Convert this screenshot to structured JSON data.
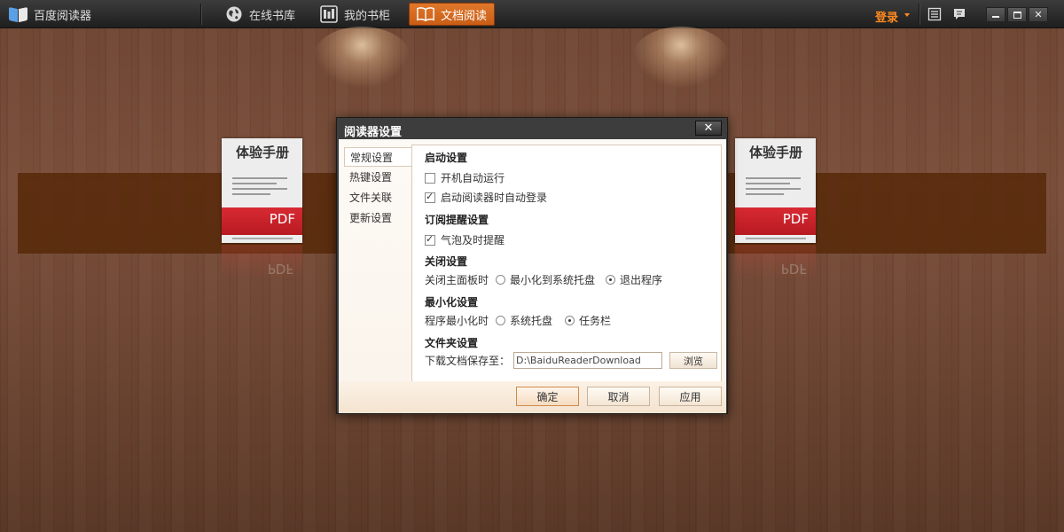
{
  "app": {
    "name": "百度阅读器"
  },
  "nav": {
    "tabs": [
      {
        "label": "在线书库",
        "icon": "globe-icon"
      },
      {
        "label": "我的书柜",
        "icon": "bookshelf-icon"
      },
      {
        "label": "文档阅读",
        "icon": "open-book-icon",
        "active": true
      }
    ],
    "login_label": "登录"
  },
  "colors": {
    "accent": "#d5661c",
    "login": "#ff8a1f",
    "shelf": "#5a2b0d",
    "pdf_red": "#c8202a"
  },
  "books": [
    {
      "title": "体验手册",
      "badge": "PDF"
    },
    {
      "title": "体验手册",
      "badge": "PDF"
    }
  ],
  "dialog": {
    "title": "阅读器设置",
    "close_label": "✕",
    "sidebar": [
      "常规设置",
      "热键设置",
      "文件关联",
      "更新设置"
    ],
    "sections": {
      "startup": {
        "title": "启动设置",
        "auto_run": {
          "label": "开机自动运行",
          "checked": false
        },
        "auto_login": {
          "label": "启动阅读器时自动登录",
          "checked": true
        }
      },
      "subscription": {
        "title": "订阅提醒设置",
        "bubble": {
          "label": "气泡及时提醒",
          "checked": true
        }
      },
      "close": {
        "title": "关闭设置",
        "prefix": "关闭主面板时",
        "options": [
          "最小化到系统托盘",
          "退出程序"
        ],
        "selected": 1
      },
      "minimize": {
        "title": "最小化设置",
        "prefix": "程序最小化时",
        "options": [
          "系统托盘",
          "任务栏"
        ],
        "selected": 1
      },
      "folder": {
        "title": "文件夹设置",
        "prefix": "下载文档保存至：",
        "path": "D:\\BaiduReaderDownload",
        "browse_label": "浏览"
      }
    },
    "buttons": {
      "ok": "确定",
      "cancel": "取消",
      "apply": "应用"
    }
  }
}
